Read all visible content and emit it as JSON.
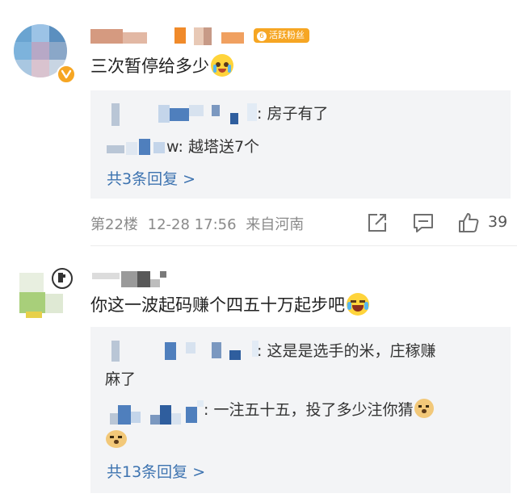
{
  "comments": [
    {
      "text": "三次暂停给多少",
      "badge_label": "活跃粉丝",
      "badge_level": "6",
      "replies": [
        {
          "text": ": 房子有了"
        },
        {
          "text": "w: 越塔送7个"
        }
      ],
      "more_replies": "共3条回复 >",
      "floor": "第22楼",
      "time": "12-28 17:56",
      "location": "来自河南",
      "like_count": "39"
    },
    {
      "text": "你这一波起码赚个四五十万起步吧",
      "replies": [
        {
          "text": ": 这是是选手的米，庄稼赚",
          "text2": "麻了"
        },
        {
          "text": ": 一注五十五，投了多少注你猜"
        }
      ],
      "more_replies": "共13条回复 >"
    }
  ],
  "icons": {
    "verified": "verified-v-icon",
    "share": "share-icon",
    "comment": "comment-icon",
    "like": "thumbs-up-icon"
  },
  "colors": {
    "link": "#3d73b0",
    "badge": "#f6a623",
    "reply_bg": "#f3f4f6"
  }
}
